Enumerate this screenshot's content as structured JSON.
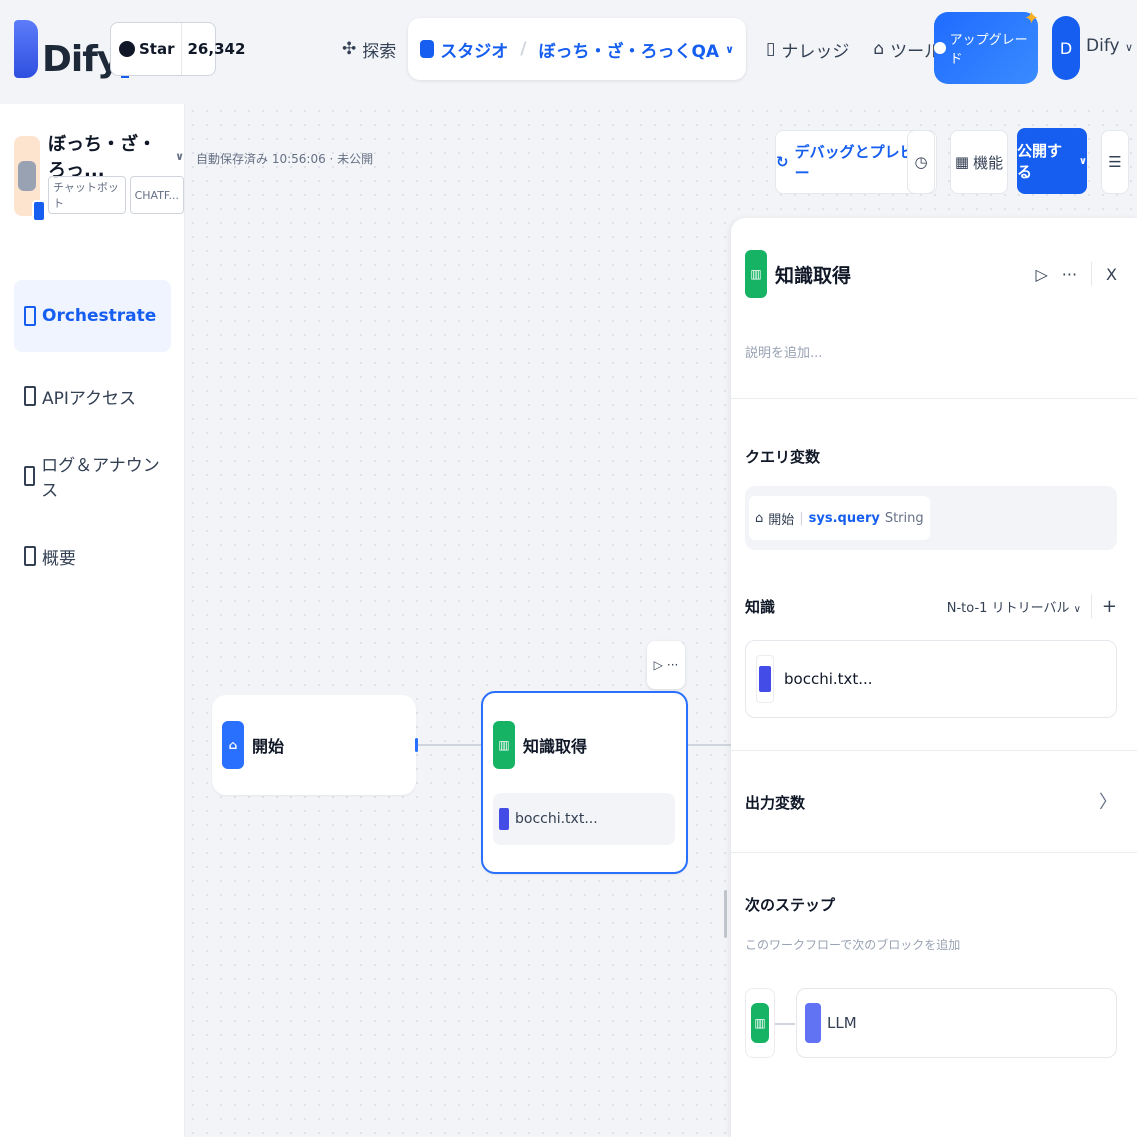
{
  "header": {
    "logo_text": "Dify",
    "github": {
      "label": "Star",
      "count": "26,342"
    },
    "nav": [
      {
        "label": "探索"
      },
      {
        "label": "スタジオ",
        "app": "ぼっち・ざ・ろっくQA"
      },
      {
        "label": "ナレッジ"
      },
      {
        "label": "ツール"
      }
    ],
    "upgrade_label": "アップグレード",
    "avatar_initial": "D",
    "user_name": "Dify"
  },
  "sidebar": {
    "app_name": "ぼっち・ざ・ろっ...",
    "tags": [
      "チャットボット",
      "CHATF..."
    ],
    "items": [
      {
        "label": "Orchestrate",
        "active": true
      },
      {
        "label": "APIアクセス"
      },
      {
        "label": "ログ＆アナウンス"
      },
      {
        "label": "概要"
      }
    ]
  },
  "canvas": {
    "autosave": "自動保存済み 10:56:06 · 未公開",
    "toolbar": {
      "debug_label": "デバッグとプレビュー",
      "features_label": "機能",
      "publish_label": "公開する"
    },
    "nodes": {
      "start": {
        "title": "開始"
      },
      "knowledge": {
        "title": "知識取得",
        "file": "bocchi.txt..."
      }
    }
  },
  "panel": {
    "title": "知識取得",
    "description_placeholder": "説明を追加...",
    "query_label": "クエリ変数",
    "query": {
      "node": "開始",
      "variable": "sys.query",
      "type": "String"
    },
    "knowledge_label": "知識",
    "retrieval_mode": "N-to-1 リトリーバル",
    "knowledge_file": "bocchi.txt...",
    "output_label": "出力変数",
    "next_label": "次のステップ",
    "next_desc": "このワークフローで次のブロックを追加",
    "next_block": "LLM"
  },
  "colors": {
    "accent": "#155eef",
    "knowledge_green": "#16b364",
    "start_blue": "#2970ff"
  }
}
